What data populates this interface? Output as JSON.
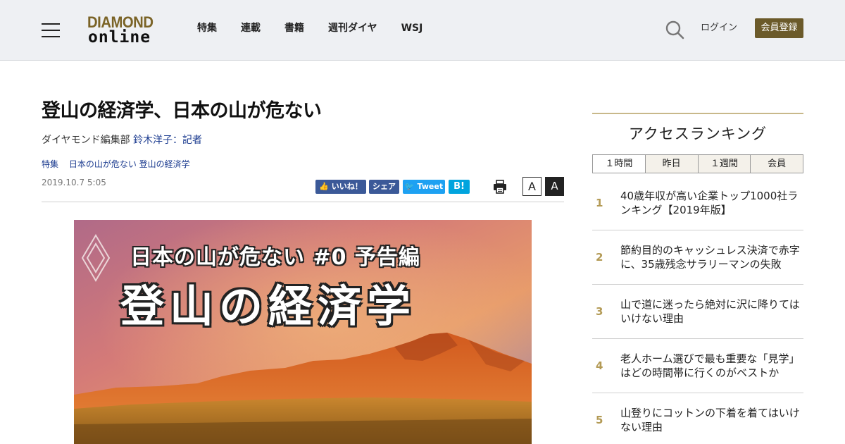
{
  "header": {
    "logo_top": "DIAMOND",
    "logo_bottom": "online",
    "nav": [
      "特集",
      "連載",
      "書籍",
      "週刊ダイヤ",
      "WSJ"
    ],
    "login_label": "ログイン",
    "register_label": "会員登録"
  },
  "article": {
    "title": "登山の経済学、日本の山が危ない",
    "byline_prefix": "ダイヤモンド編集部 ",
    "author": "鈴木洋子",
    "author_suffix": "：記者",
    "tags": [
      "特集",
      "日本の山が危ない 登山の経済学"
    ],
    "date": "2019.10.7 5:05",
    "share": {
      "fb_like": "いいね！",
      "fb_share": "シェア",
      "tweet": "Tweet",
      "hatena": "B!"
    },
    "font_small_label": "A",
    "font_large_label": "A",
    "hero_line1": "日本の山が危ない #0 予告編",
    "hero_line2": "登山の経済学"
  },
  "sidebar": {
    "ranking_title": "アクセスランキング",
    "tabs": [
      "１時間",
      "昨日",
      "１週間",
      "会員"
    ],
    "items": [
      {
        "rank": "1",
        "title": "40歳年収が高い企業トップ1000社ランキング【2019年版】"
      },
      {
        "rank": "2",
        "title": "節約目的のキャッシュレス決済で赤字に、35歳残念サラリーマンの失敗"
      },
      {
        "rank": "3",
        "title": "山で道に迷ったら絶対に沢に降りてはいけない理由"
      },
      {
        "rank": "4",
        "title": "老人ホーム選びで最も重要な「見学」はどの時間帯に行くのがベストか"
      },
      {
        "rank": "5",
        "title": "山登りにコットンの下着を着てはいけない理由"
      }
    ]
  },
  "colors": {
    "brand_gold": "#7a6326",
    "register_bg": "#6b5a2a",
    "rank_number": "#b39a55",
    "link_blue": "#1a3a8f"
  }
}
